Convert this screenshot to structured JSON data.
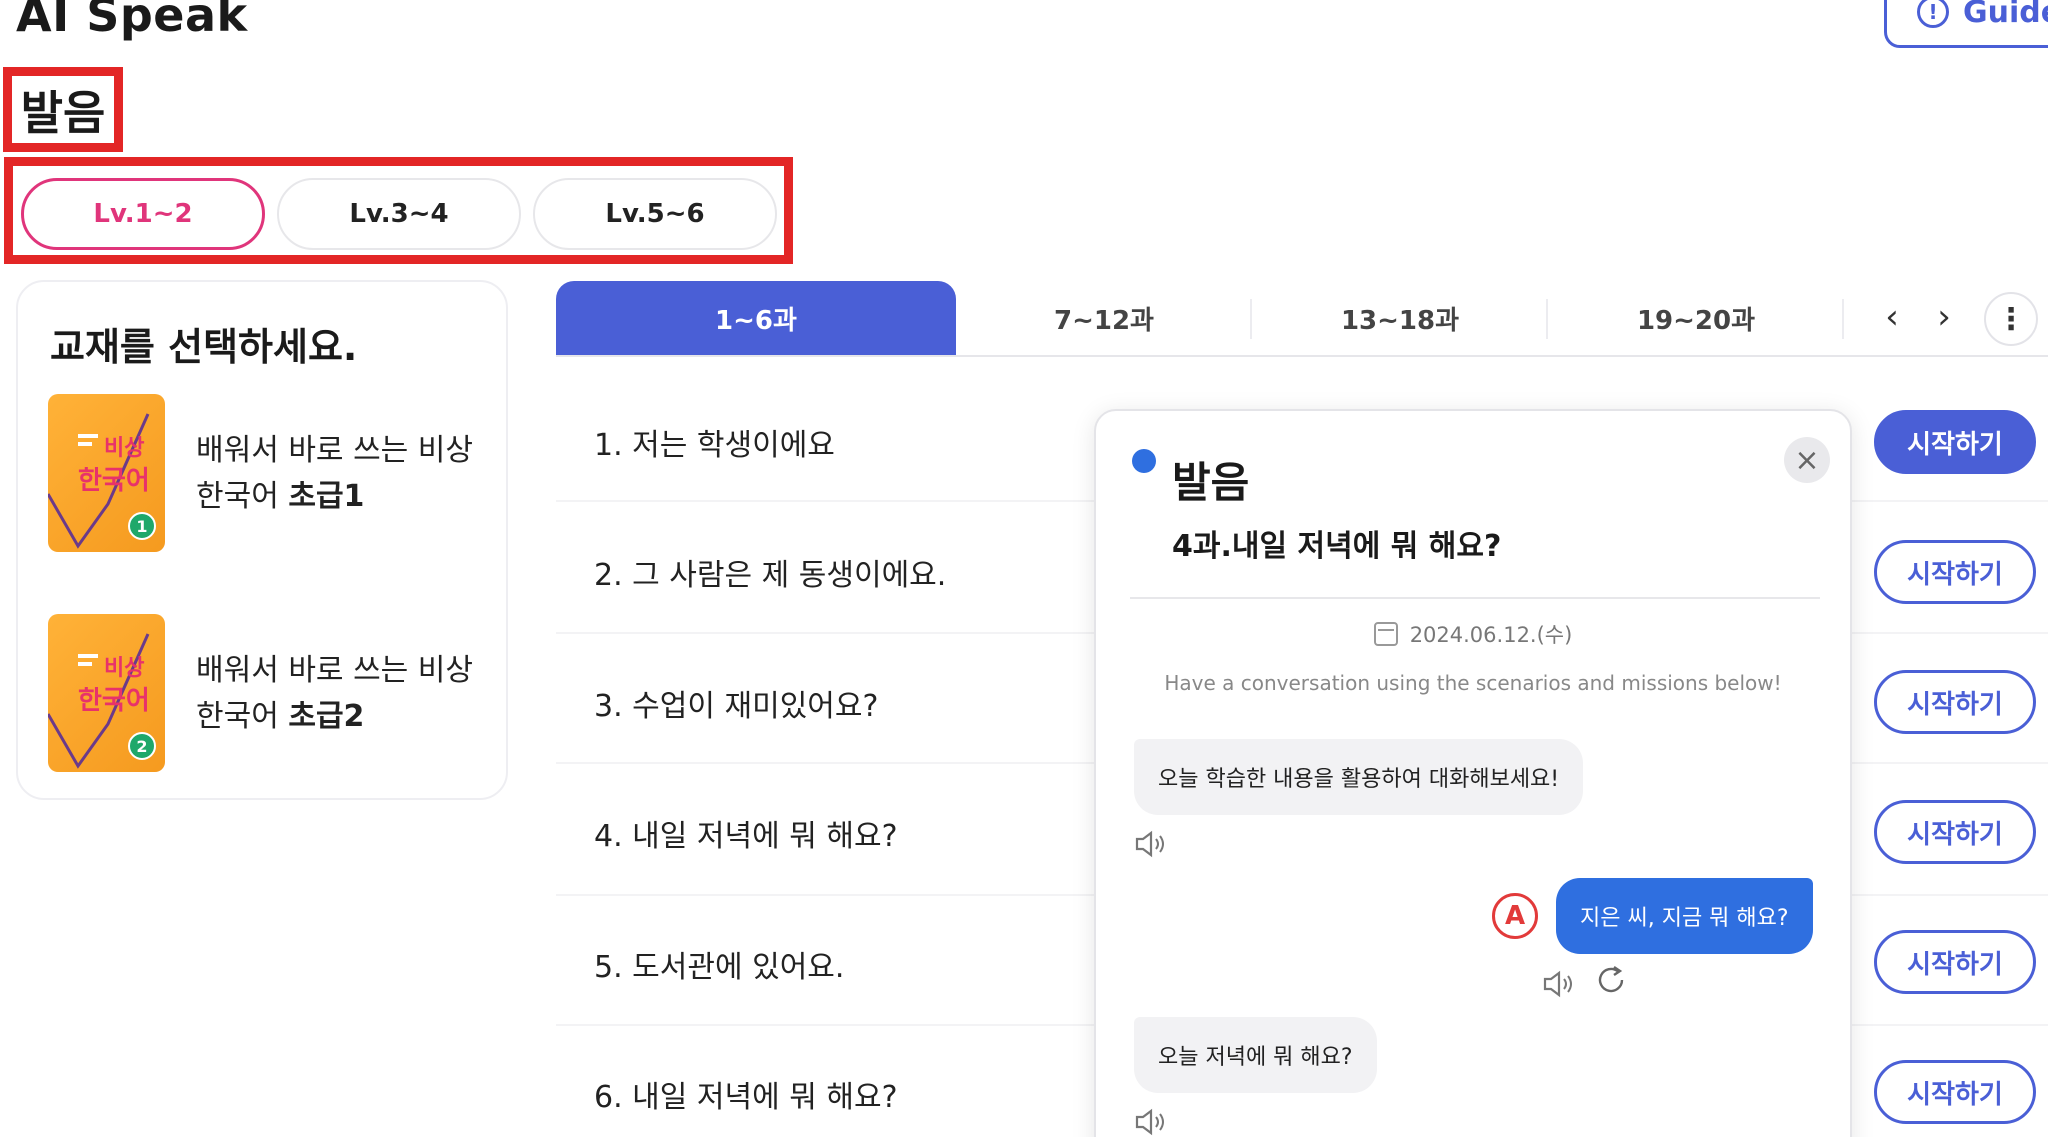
{
  "app": {
    "title": "AI Speak",
    "guide_label": "Guide",
    "guide_icon": "!"
  },
  "section": {
    "title": "발음"
  },
  "levels": [
    {
      "label": "Lv.1~2",
      "active": true
    },
    {
      "label": "Lv.3~4",
      "active": false
    },
    {
      "label": "Lv.5~6",
      "active": false
    }
  ],
  "textbook": {
    "heading": "교재를 선택하세요.",
    "books": [
      {
        "title_line1": "배워서 바로 쓰는 비상",
        "title_line2_prefix": "한국어 ",
        "title_line2_bold": "초급1",
        "cover_t1": "비상",
        "cover_t2": "한국어",
        "cover_num": "1"
      },
      {
        "title_line1": "배워서 바로 쓰는 비상",
        "title_line2_prefix": "한국어 ",
        "title_line2_bold": "초급2",
        "cover_t1": "비상",
        "cover_t2": "한국어",
        "cover_num": "2"
      }
    ]
  },
  "tabs": [
    {
      "label": "1~6과",
      "active": true
    },
    {
      "label": "7~12과",
      "active": false
    },
    {
      "label": "13~18과",
      "active": false
    },
    {
      "label": "19~20과",
      "active": false
    }
  ],
  "nav": {
    "prev": "‹",
    "next": "›",
    "more": "⋮"
  },
  "lessons": [
    {
      "label": "1. 저는 학생이에요",
      "button": "시작하기",
      "primary": true
    },
    {
      "label": "2. 그 사람은 제 동생이에요.",
      "button": "시작하기",
      "primary": false
    },
    {
      "label": "3. 수업이 재미있어요?",
      "button": "시작하기",
      "primary": false
    },
    {
      "label": "4. 내일 저녁에 뭐 해요?",
      "button": "시작하기",
      "primary": false
    },
    {
      "label": "5. 도서관에 있어요.",
      "button": "시작하기",
      "primary": false
    },
    {
      "label": "6. 내일 저녁에 뭐 해요?",
      "button": "시작하기",
      "primary": false
    }
  ],
  "modal": {
    "title": "발음",
    "subtitle": "4과.내일 저녁에 뭐 해요?",
    "close": "×",
    "date": "2024.06.12.(수)",
    "instruction": "Have a conversation using the scenarios and missions below!",
    "messages": [
      {
        "from": "ai",
        "text": "오늘 학습한 내용을 활용하여 대화해보세요!"
      },
      {
        "from": "me",
        "text": "지은 씨, 지금 뭐 해요?",
        "avatar": "A"
      },
      {
        "from": "ai",
        "text": "오늘 저녁에 뭐 해요?"
      }
    ]
  },
  "colors": {
    "primary": "#4a5fd6",
    "accent_pink": "#e0357b",
    "highlight_red": "#e32626",
    "chat_blue": "#2f6fe0"
  }
}
